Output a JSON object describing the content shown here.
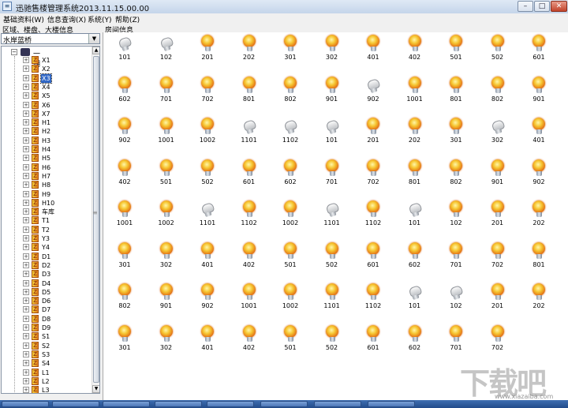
{
  "window": {
    "title": "迅驰售楼管理系统2013.11.15.00.00",
    "minimize_glyph": "–",
    "maximize_glyph": "□",
    "close_glyph": "✕"
  },
  "menu": [
    "基础资料(W)",
    "信息查询(X)",
    "系统(Y)",
    "帮助(Z)"
  ],
  "left": {
    "header": "区域、楼盘、大楼信息",
    "combo_value": "水岸蓝桥",
    "root_label": "一期",
    "selected": "X3",
    "buildings": [
      "X1",
      "X2",
      "X3",
      "X4",
      "X5",
      "X6",
      "X7",
      "H1",
      "H2",
      "H3",
      "H4",
      "H5",
      "H6",
      "H7",
      "H8",
      "H9",
      "H10",
      "车库",
      "T1",
      "T2",
      "Y3",
      "Y4",
      "D1",
      "D2",
      "D3",
      "D4",
      "D5",
      "D6",
      "D7",
      "D8",
      "D9",
      "S1",
      "S2",
      "S3",
      "S4",
      "L1",
      "L2",
      "L3"
    ]
  },
  "right": {
    "header": "房间信息",
    "rows": [
      [
        {
          "n": "101",
          "s": "off"
        },
        {
          "n": "102",
          "s": "off"
        },
        {
          "n": "201",
          "s": "on"
        },
        {
          "n": "202",
          "s": "on"
        },
        {
          "n": "301",
          "s": "on"
        },
        {
          "n": "302",
          "s": "on"
        },
        {
          "n": "401",
          "s": "on"
        },
        {
          "n": "402",
          "s": "on"
        },
        {
          "n": "501",
          "s": "on"
        },
        {
          "n": "502",
          "s": "on"
        },
        {
          "n": "601",
          "s": "on"
        }
      ],
      [
        {
          "n": "602",
          "s": "on"
        },
        {
          "n": "701",
          "s": "on"
        },
        {
          "n": "702",
          "s": "on"
        },
        {
          "n": "801",
          "s": "on"
        },
        {
          "n": "802",
          "s": "on"
        },
        {
          "n": "901",
          "s": "on"
        },
        {
          "n": "902",
          "s": "off"
        },
        {
          "n": "1001",
          "s": "on"
        },
        {
          "n": "801",
          "s": "on"
        },
        {
          "n": "802",
          "s": "on"
        },
        {
          "n": "901",
          "s": "on"
        }
      ],
      [
        {
          "n": "902",
          "s": "on"
        },
        {
          "n": "1001",
          "s": "on"
        },
        {
          "n": "1002",
          "s": "on"
        },
        {
          "n": "1101",
          "s": "off"
        },
        {
          "n": "1102",
          "s": "off"
        },
        {
          "n": "101",
          "s": "off"
        },
        {
          "n": "201",
          "s": "on"
        },
        {
          "n": "202",
          "s": "on"
        },
        {
          "n": "301",
          "s": "on"
        },
        {
          "n": "302",
          "s": "off"
        },
        {
          "n": "401",
          "s": "on"
        }
      ],
      [
        {
          "n": "402",
          "s": "on"
        },
        {
          "n": "501",
          "s": "on"
        },
        {
          "n": "502",
          "s": "on"
        },
        {
          "n": "601",
          "s": "on"
        },
        {
          "n": "602",
          "s": "on"
        },
        {
          "n": "701",
          "s": "on"
        },
        {
          "n": "702",
          "s": "on"
        },
        {
          "n": "801",
          "s": "on"
        },
        {
          "n": "802",
          "s": "on"
        },
        {
          "n": "901",
          "s": "on"
        },
        {
          "n": "902",
          "s": "on"
        }
      ],
      [
        {
          "n": "1001",
          "s": "on"
        },
        {
          "n": "1002",
          "s": "on"
        },
        {
          "n": "1101",
          "s": "off"
        },
        {
          "n": "1102",
          "s": "on"
        },
        {
          "n": "1002",
          "s": "on"
        },
        {
          "n": "1101",
          "s": "off"
        },
        {
          "n": "1102",
          "s": "on"
        },
        {
          "n": "101",
          "s": "off"
        },
        {
          "n": "102",
          "s": "on"
        },
        {
          "n": "201",
          "s": "on"
        },
        {
          "n": "202",
          "s": "on"
        }
      ],
      [
        {
          "n": "301",
          "s": "on"
        },
        {
          "n": "302",
          "s": "on"
        },
        {
          "n": "401",
          "s": "on"
        },
        {
          "n": "402",
          "s": "on"
        },
        {
          "n": "501",
          "s": "on"
        },
        {
          "n": "502",
          "s": "on"
        },
        {
          "n": "601",
          "s": "on"
        },
        {
          "n": "602",
          "s": "on"
        },
        {
          "n": "701",
          "s": "on"
        },
        {
          "n": "702",
          "s": "on"
        },
        {
          "n": "801",
          "s": "on"
        }
      ],
      [
        {
          "n": "802",
          "s": "on"
        },
        {
          "n": "901",
          "s": "on"
        },
        {
          "n": "902",
          "s": "on"
        },
        {
          "n": "1001",
          "s": "on"
        },
        {
          "n": "1002",
          "s": "on"
        },
        {
          "n": "1101",
          "s": "on"
        },
        {
          "n": "1102",
          "s": "on"
        },
        {
          "n": "101",
          "s": "off"
        },
        {
          "n": "102",
          "s": "off"
        },
        {
          "n": "201",
          "s": "on"
        },
        {
          "n": "202",
          "s": "on"
        }
      ],
      [
        {
          "n": "301",
          "s": "on"
        },
        {
          "n": "302",
          "s": "on"
        },
        {
          "n": "401",
          "s": "on"
        },
        {
          "n": "402",
          "s": "on"
        },
        {
          "n": "501",
          "s": "on"
        },
        {
          "n": "502",
          "s": "on"
        },
        {
          "n": "601",
          "s": "on"
        },
        {
          "n": "602",
          "s": "on"
        },
        {
          "n": "701",
          "s": "on"
        },
        {
          "n": "702",
          "s": "on"
        }
      ]
    ]
  },
  "colors": {
    "selection": "#3168c6",
    "taskbar": "#224b8a"
  },
  "watermark": {
    "text": "下载吧",
    "url": "www.xiazaiba.com"
  }
}
